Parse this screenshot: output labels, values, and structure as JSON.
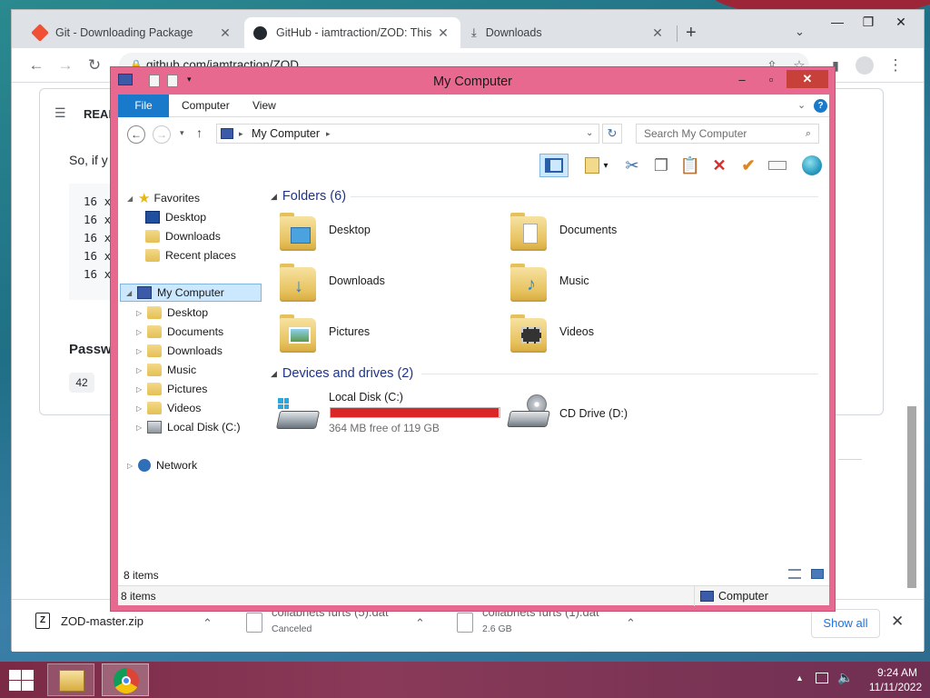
{
  "browser": {
    "tabs": [
      {
        "label": "Git - Downloading Package",
        "icon": "git-icon"
      },
      {
        "label": "GitHub - iamtraction/ZOD: This i",
        "icon": "github-icon"
      },
      {
        "label": "Downloads",
        "icon": "download-icon"
      }
    ],
    "url": "github.com/iamtraction/ZOD",
    "page": {
      "readme_label": "READ",
      "intro_text": "So, if y",
      "code_lines": [
        "16 x",
        "16 x",
        "16 x",
        "16 x",
        "16 x"
      ],
      "passwd_label": "Passw",
      "badge": "42"
    }
  },
  "downloads": {
    "items": [
      {
        "name": "ZOD-master.zip",
        "sub": ""
      },
      {
        "name": "collabnets furts (5).dat",
        "sub": "Canceled"
      },
      {
        "name": "collabnets furts (1).dat",
        "sub": "2.6 GB"
      }
    ],
    "show_all": "Show all"
  },
  "explorer": {
    "title": "My Computer",
    "ribbon_tabs": [
      "File",
      "Computer",
      "View"
    ],
    "address": "My Computer",
    "search_placeholder": "Search My Computer",
    "nav": {
      "favorites": "Favorites",
      "fav_items": [
        "Desktop",
        "Downloads",
        "Recent places"
      ],
      "my_computer": "My Computer",
      "pc_items": [
        "Desktop",
        "Documents",
        "Downloads",
        "Music",
        "Pictures",
        "Videos",
        "Local Disk (C:)"
      ],
      "network": "Network"
    },
    "folders_header": "Folders (6)",
    "folders": [
      "Desktop",
      "Documents",
      "Downloads",
      "Music",
      "Pictures",
      "Videos"
    ],
    "devices_header": "Devices and drives (2)",
    "local_disk": {
      "name": "Local Disk (C:)",
      "free": "364 MB free of 119 GB",
      "used_fraction": 0.997,
      "bar_color": "#da2626"
    },
    "cd_drive": "CD Drive (D:)",
    "item_count": "8 items",
    "status_count": "8 items",
    "status_location": "Computer"
  },
  "taskbar": {
    "time": "9:24 AM",
    "date": "11/11/2022"
  }
}
